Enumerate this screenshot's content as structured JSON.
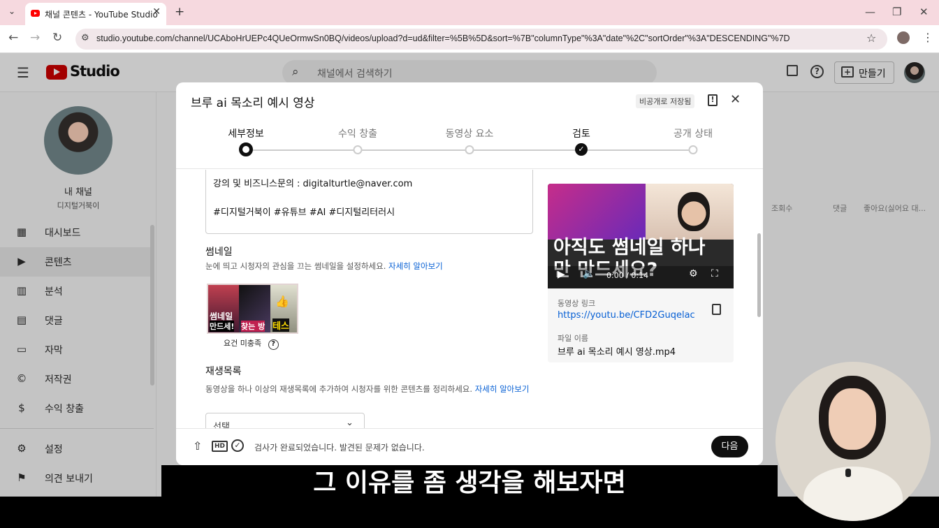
{
  "browser": {
    "tab_title": "채널 콘텐츠 - YouTube Studio",
    "url": "studio.youtube.com/channel/UCAboHrUEPc4QUeOrmwSn0BQ/videos/upload?d=ud&filter=%5B%5D&sort=%7B\"columnType\"%3A\"date\"%2C\"sortOrder\"%3A\"DESCENDING\"%7D"
  },
  "header": {
    "logo_text": "Studio",
    "search_placeholder": "채널에서 검색하기",
    "create_label": "만들기"
  },
  "sidebar": {
    "channel_title": "내 채널",
    "channel_name": "디지털거북이",
    "items": [
      {
        "label": "대시보드",
        "icon": "dashboard-icon"
      },
      {
        "label": "콘텐츠",
        "icon": "content-icon"
      },
      {
        "label": "분석",
        "icon": "analytics-icon"
      },
      {
        "label": "댓글",
        "icon": "comments-icon"
      },
      {
        "label": "자막",
        "icon": "subtitles-icon"
      },
      {
        "label": "저작권",
        "icon": "copyright-icon"
      },
      {
        "label": "수익 창출",
        "icon": "dollar-icon"
      },
      {
        "label": "설정",
        "icon": "gear-icon"
      },
      {
        "label": "의견 보내기",
        "icon": "feedback-icon"
      }
    ]
  },
  "background_table": {
    "columns": [
      "조회수",
      "댓글",
      "좋아요(싫어요 대..."
    ]
  },
  "modal": {
    "title": "브루 ai 목소리 예시 영상",
    "draft_badge": "비공개로 저장됨",
    "steps": [
      {
        "label": "세부정보",
        "state": "current"
      },
      {
        "label": "수익 창출",
        "state": "pending"
      },
      {
        "label": "동영상 요소",
        "state": "pending"
      },
      {
        "label": "검토",
        "state": "done"
      },
      {
        "label": "공개 상태",
        "state": "pending"
      }
    ],
    "description": {
      "line1": "강의 및 비즈니스문의 : digitalturtle@naver.com",
      "line2": "#디지털거북이 #유튜브 #AI #디지털리터러시"
    },
    "thumbnail": {
      "title": "썸네일",
      "desc": "눈에 띄고 시청자의 관심을 끄는 썸네일을 설정하세요.",
      "link": "자세히 알아보기",
      "note": "요건 미충족",
      "image_text_1": "썸네일",
      "image_text_2": "만드세!",
      "image_text_3": "찾는 방",
      "image_text_4": "테스"
    },
    "playlist": {
      "title": "재생목록",
      "desc": "동영상을 하나 이상의 재생목록에 추가하여 시청자를 위한 콘텐츠를 정리하세요.",
      "link": "자세히 알아보기",
      "select_value": "선택"
    },
    "video": {
      "overlay_text": "아직도 썸네일 하나만 만드세요?",
      "time": "0:00 / 0:14",
      "link_label": "동영상 링크",
      "link": "https://youtu.be/CFD2Guqelac",
      "file_label": "파일 이름",
      "file_name": "브루 ai 목소리 예시 영상.mp4"
    },
    "footer": {
      "status": "검사가 완료되었습니다. 발견된 문제가 없습니다.",
      "next_label": "다음"
    }
  },
  "caption": "그 이유를 좀 생각을 해보자면"
}
